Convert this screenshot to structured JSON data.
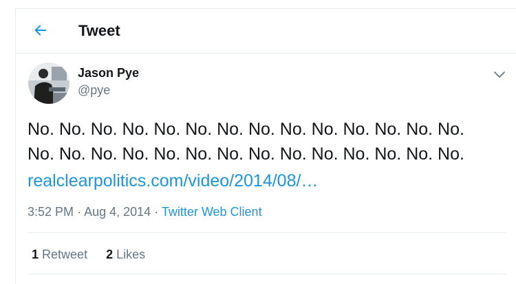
{
  "header": {
    "title": "Tweet"
  },
  "tweet": {
    "author_name": "Jason Pye",
    "author_handle": "@pye",
    "text_line1": "No. No. No. No. No. No. No. No. No. No. No. No. No. No.",
    "text_line2": "No. No. No. No. No. No. No. No. No. No. No. No. No. No.",
    "link": "realclearpolitics.com/video/2014/08/…",
    "time": "3:52 PM",
    "date": "Aug 4, 2014",
    "source": "Twitter Web Client",
    "retweet_count": "1",
    "retweet_label": "Retweet",
    "like_count": "2",
    "like_label": "Likes"
  },
  "colors": {
    "accent": "#1b95e0",
    "secondary": "#657786",
    "text": "#14171a",
    "border": "#e6ecf0"
  },
  "icons": {
    "back": "back-arrow-icon",
    "menu": "chevron-down-icon"
  }
}
